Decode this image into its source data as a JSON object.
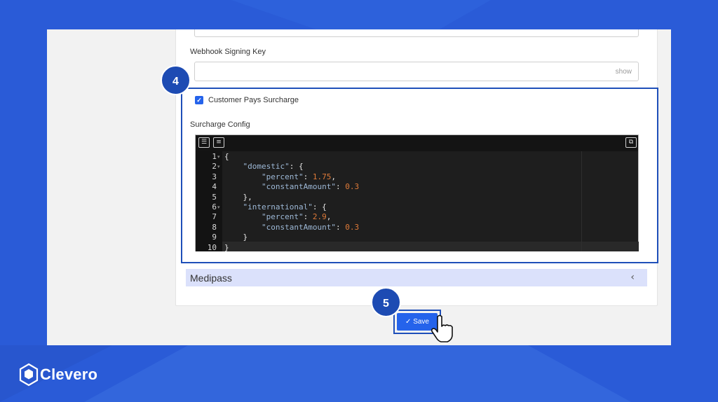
{
  "brand": {
    "name": "Clevero",
    "background_color": "#2a5bd7",
    "accent_color": "#1d4bb3"
  },
  "form": {
    "webhook_signing_key": {
      "label": "Webhook Signing Key",
      "value": "",
      "show_label": "show"
    },
    "customer_pays_surcharge": {
      "label": "Customer Pays Surcharge",
      "checked": true
    },
    "surcharge_config": {
      "label": "Surcharge Config",
      "toolbar_icons": [
        "indent-icon",
        "format-icon",
        "fullscreen-icon"
      ],
      "lines": [
        {
          "no": "1",
          "fold": "▾",
          "tokens": [
            {
              "t": "plain",
              "v": "{"
            }
          ]
        },
        {
          "no": "2",
          "fold": "▾",
          "tokens": [
            {
              "t": "plain",
              "v": "    "
            },
            {
              "t": "key",
              "v": "\"domestic\""
            },
            {
              "t": "plain",
              "v": ": {"
            }
          ]
        },
        {
          "no": "3",
          "fold": "",
          "tokens": [
            {
              "t": "plain",
              "v": "        "
            },
            {
              "t": "key",
              "v": "\"percent\""
            },
            {
              "t": "plain",
              "v": ": "
            },
            {
              "t": "num",
              "v": "1.75"
            },
            {
              "t": "plain",
              "v": ","
            }
          ]
        },
        {
          "no": "4",
          "fold": "",
          "tokens": [
            {
              "t": "plain",
              "v": "        "
            },
            {
              "t": "key",
              "v": "\"constantAmount\""
            },
            {
              "t": "plain",
              "v": ": "
            },
            {
              "t": "num",
              "v": "0.3"
            }
          ]
        },
        {
          "no": "5",
          "fold": "",
          "tokens": [
            {
              "t": "plain",
              "v": "    },"
            }
          ]
        },
        {
          "no": "6",
          "fold": "▾",
          "tokens": [
            {
              "t": "plain",
              "v": "    "
            },
            {
              "t": "key",
              "v": "\"international\""
            },
            {
              "t": "plain",
              "v": ": {"
            }
          ]
        },
        {
          "no": "7",
          "fold": "",
          "tokens": [
            {
              "t": "plain",
              "v": "        "
            },
            {
              "t": "key",
              "v": "\"percent\""
            },
            {
              "t": "plain",
              "v": ": "
            },
            {
              "t": "num",
              "v": "2.9"
            },
            {
              "t": "plain",
              "v": ","
            }
          ]
        },
        {
          "no": "8",
          "fold": "",
          "tokens": [
            {
              "t": "plain",
              "v": "        "
            },
            {
              "t": "key",
              "v": "\"constantAmount\""
            },
            {
              "t": "plain",
              "v": ": "
            },
            {
              "t": "num",
              "v": "0.3"
            }
          ]
        },
        {
          "no": "9",
          "fold": "",
          "tokens": [
            {
              "t": "plain",
              "v": "    }"
            }
          ]
        },
        {
          "no": "10",
          "fold": "",
          "tokens": [
            {
              "t": "plain",
              "v": "}"
            }
          ]
        }
      ]
    }
  },
  "sections": {
    "medipass": {
      "title": "Medipass",
      "chevron": "‹"
    }
  },
  "actions": {
    "save_label": "Save"
  },
  "annotations": {
    "step4": "4",
    "step5": "5"
  }
}
